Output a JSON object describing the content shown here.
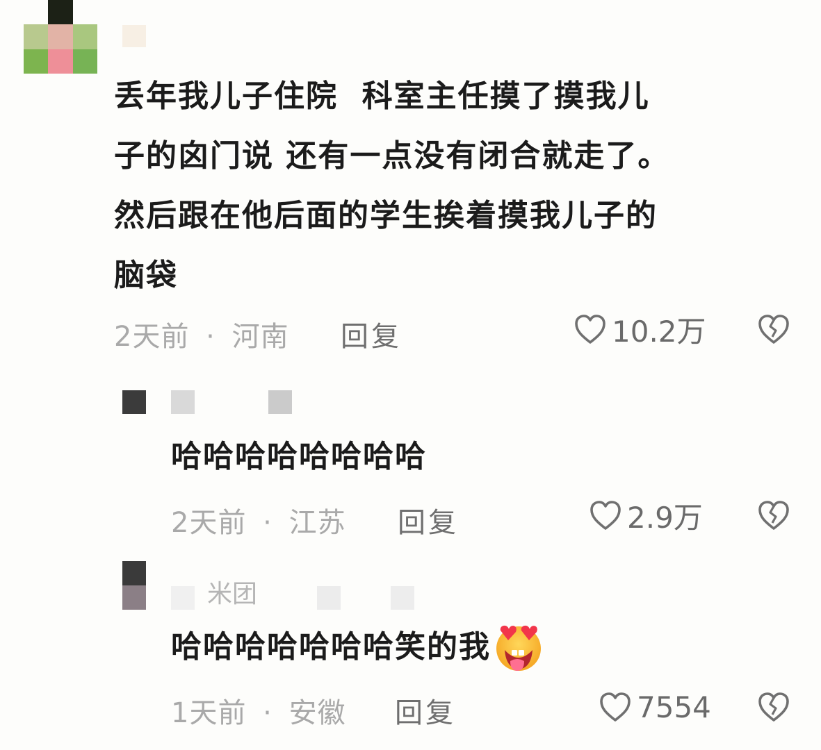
{
  "comments": [
    {
      "username": "",
      "text_lines": [
        "丢年我儿子住院  科室主任摸了摸我儿",
        "子的囟门说 还有一点没有闭合就走了。",
        "然后跟在他后面的学生挨着摸我儿子的",
        "脑袋"
      ],
      "time": "2天前",
      "location": "河南",
      "reply_label": "回复",
      "likes": "10.2万"
    },
    {
      "username": "",
      "text": "哈哈哈哈哈哈哈哈",
      "time": "2天前",
      "location": "江苏",
      "reply_label": "回复",
      "likes": "2.9万"
    },
    {
      "username": "米团",
      "text": "哈哈哈哈哈哈哈笑的我",
      "emoji": "star-struck-tongue-emoji",
      "time": "1天前",
      "location": "安徽",
      "reply_label": "回复",
      "likes": "7554"
    }
  ],
  "separator": "·",
  "icons": {
    "like": "heart-outline-icon",
    "dislike": "broken-heart-icon"
  },
  "colors": {
    "text": "#1b1b1b",
    "meta": "#a9a9a9",
    "reply": "#6f6f6f",
    "likes": "#6a6a6a"
  }
}
